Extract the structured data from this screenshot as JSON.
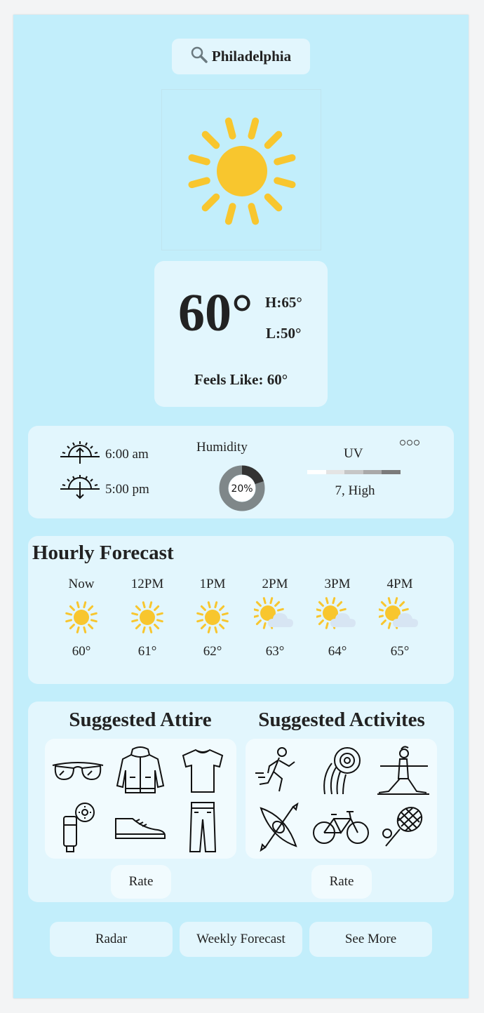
{
  "search": {
    "city": "Philadelphia"
  },
  "current": {
    "temp": "60°",
    "high": "H:65°",
    "low": "L:50°",
    "feels_like": "Feels Like: 60°"
  },
  "sun": {
    "sunrise": "6:00 am",
    "sunset": "5:00 pm"
  },
  "humidity": {
    "title": "Humidity",
    "value": "20%",
    "fraction": 0.2
  },
  "uv": {
    "title": "UV",
    "value": "7, High",
    "bar_colors": [
      "#ffffff",
      "#e4e4e4",
      "#c6c6c6",
      "#a9a9a9",
      "#7b7b7b"
    ]
  },
  "hourly": {
    "title": "Hourly Forecast",
    "hours": [
      {
        "time": "Now",
        "temp": "60°",
        "icon": "sun-icon"
      },
      {
        "time": "12PM",
        "temp": "61°",
        "icon": "sun-icon"
      },
      {
        "time": "1PM",
        "temp": "62°",
        "icon": "sun-icon"
      },
      {
        "time": "2PM",
        "temp": "63°",
        "icon": "partly-cloudy-icon"
      },
      {
        "time": "3PM",
        "temp": "64°",
        "icon": "partly-cloudy-icon"
      },
      {
        "time": "4PM",
        "temp": "65°",
        "icon": "partly-cloudy-icon"
      }
    ]
  },
  "attire": {
    "title": "Suggested Attire",
    "items": [
      "sunglasses-icon",
      "jacket-icon",
      "tshirt-icon",
      "sunscreen-icon",
      "sneaker-icon",
      "jeans-icon"
    ],
    "rate_label": "Rate"
  },
  "activities": {
    "title": "Suggested Activites",
    "items": [
      "running-icon",
      "frisbee-icon",
      "yoga-icon",
      "kayak-icon",
      "bicycle-icon",
      "tennis-icon"
    ],
    "rate_label": "Rate"
  },
  "nav": {
    "radar": "Radar",
    "weekly": "Weekly Forecast",
    "more": "See More"
  },
  "colors": {
    "background": "#c2eefb",
    "card": "#e2f6fd",
    "sun": "#f8c62e",
    "cloud": "#d7e5f3"
  }
}
